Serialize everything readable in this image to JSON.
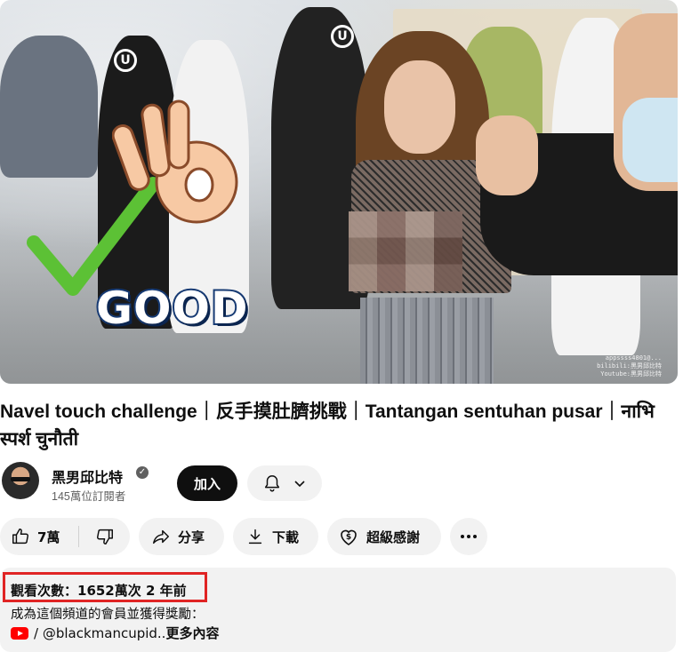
{
  "video": {
    "overlay_text": "GOOD",
    "hood_logo": "U",
    "watermark_lines": [
      "appssss4801@...",
      "bilibili:黑男邱比特",
      "Youtube:黑男邱比特"
    ]
  },
  "title": "Navel touch challenge｜反手摸肚臍挑戰｜Tantangan sentuhan pusar｜नाभि स्पर्श चुनौती",
  "channel": {
    "name": "黑男邱比特",
    "subscribers": "145萬位訂閱者",
    "join_label": "加入",
    "verified_icon": "check-circle-icon",
    "bell_icon": "bell-icon"
  },
  "actions": {
    "like_count": "7萬",
    "share_label": "分享",
    "download_label": "下載",
    "thanks_label": "超級感謝",
    "more_icon": "more-horizontal-icon"
  },
  "description": {
    "views_and_date": "觀看次數：1652萬次  2 年前",
    "line1": "成為這個頻道的會員並獲得獎勵：",
    "link_text": "/ @blackmancupid..",
    "more_label": "更多內容"
  },
  "colors": {
    "highlight_box": "#e02424",
    "youtube_red": "#ff0000",
    "check_green": "#5cc135"
  }
}
